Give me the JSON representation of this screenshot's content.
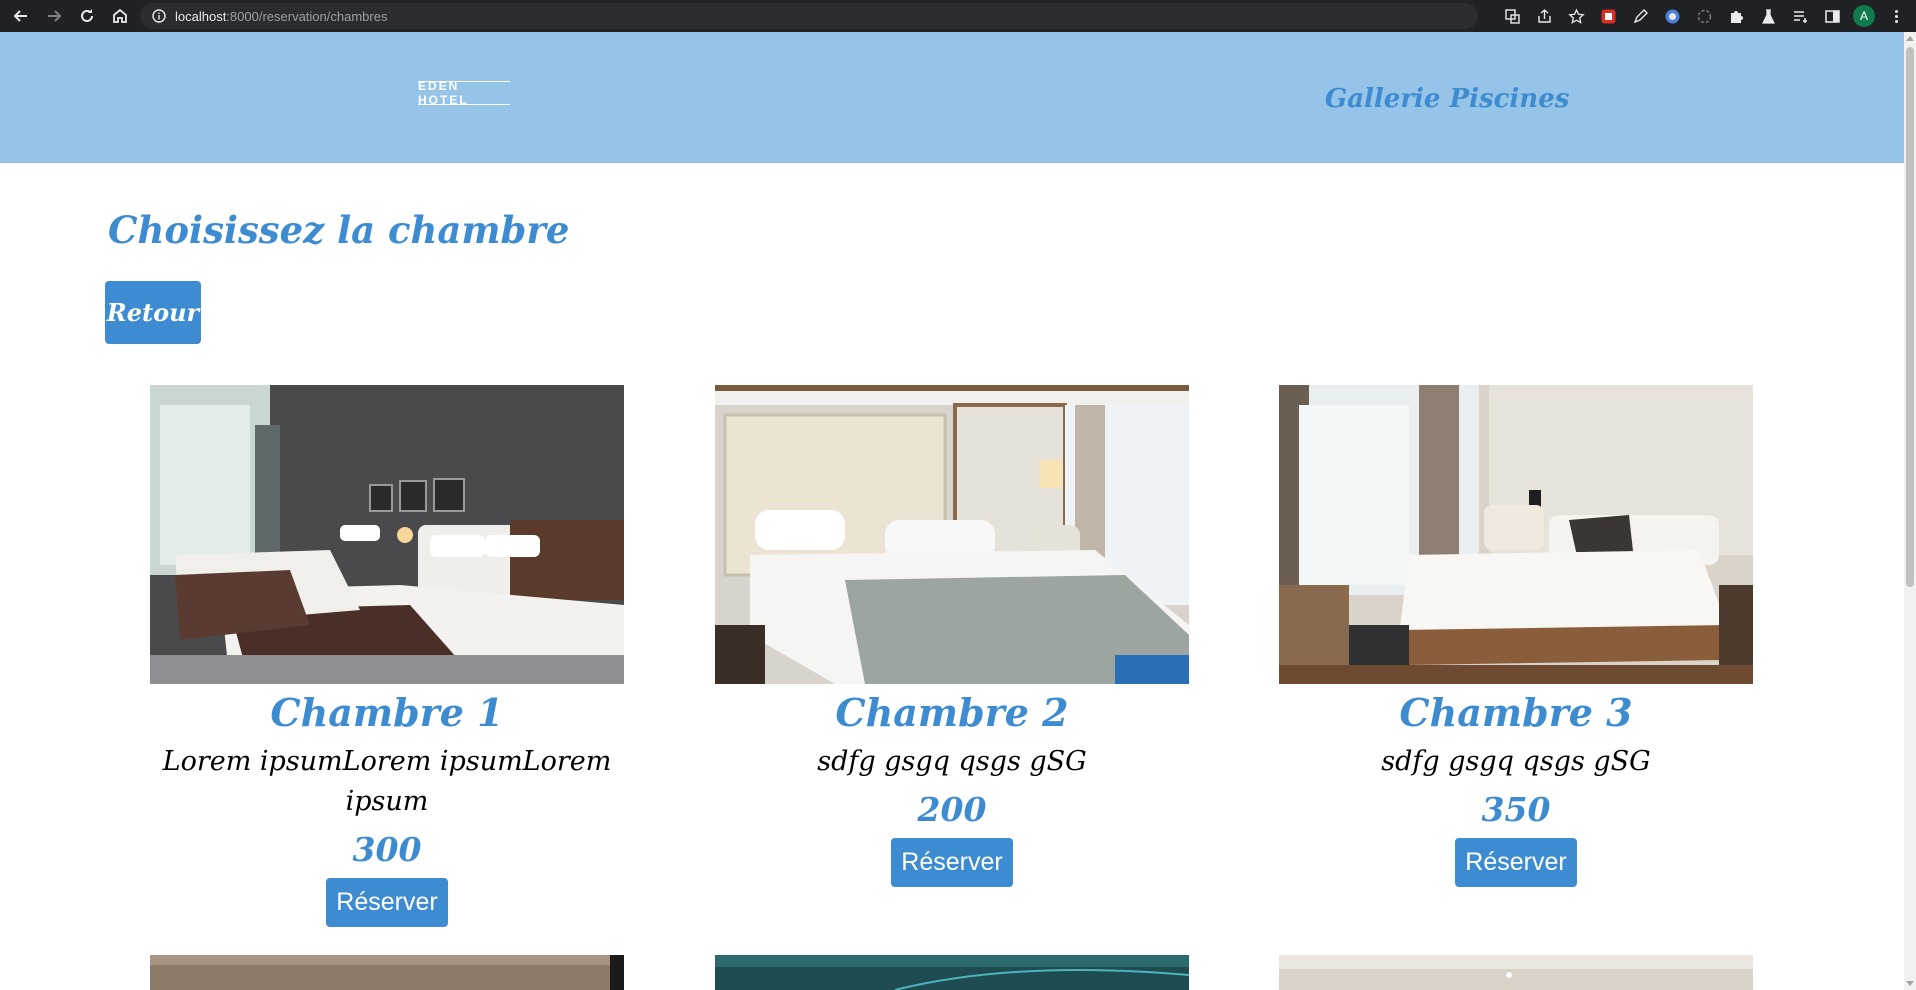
{
  "browser": {
    "url_host": "localhost",
    "url_path": ":8000/reservation/chambres",
    "avatar_letter": "A"
  },
  "header": {
    "logo_text": "EDEN HOTEL",
    "nav_link": "Gallerie Piscines",
    "background": "#95c4e8",
    "accent": "#3d8bd0"
  },
  "page": {
    "title": "Choisissez la chambre",
    "back_label": "Retour"
  },
  "rooms": [
    {
      "title": "Chambre 1",
      "description": "Lorem ipsumLorem ipsumLorem ipsum",
      "price": "300",
      "button": "Réserver"
    },
    {
      "title": "Chambre 2",
      "description": "sdfg gsgq qsgs gSG",
      "price": "200",
      "button": "Réserver"
    },
    {
      "title": "Chambre 3",
      "description": "sdfg gsgq qsgs gSG",
      "price": "350",
      "button": "Réserver"
    }
  ]
}
